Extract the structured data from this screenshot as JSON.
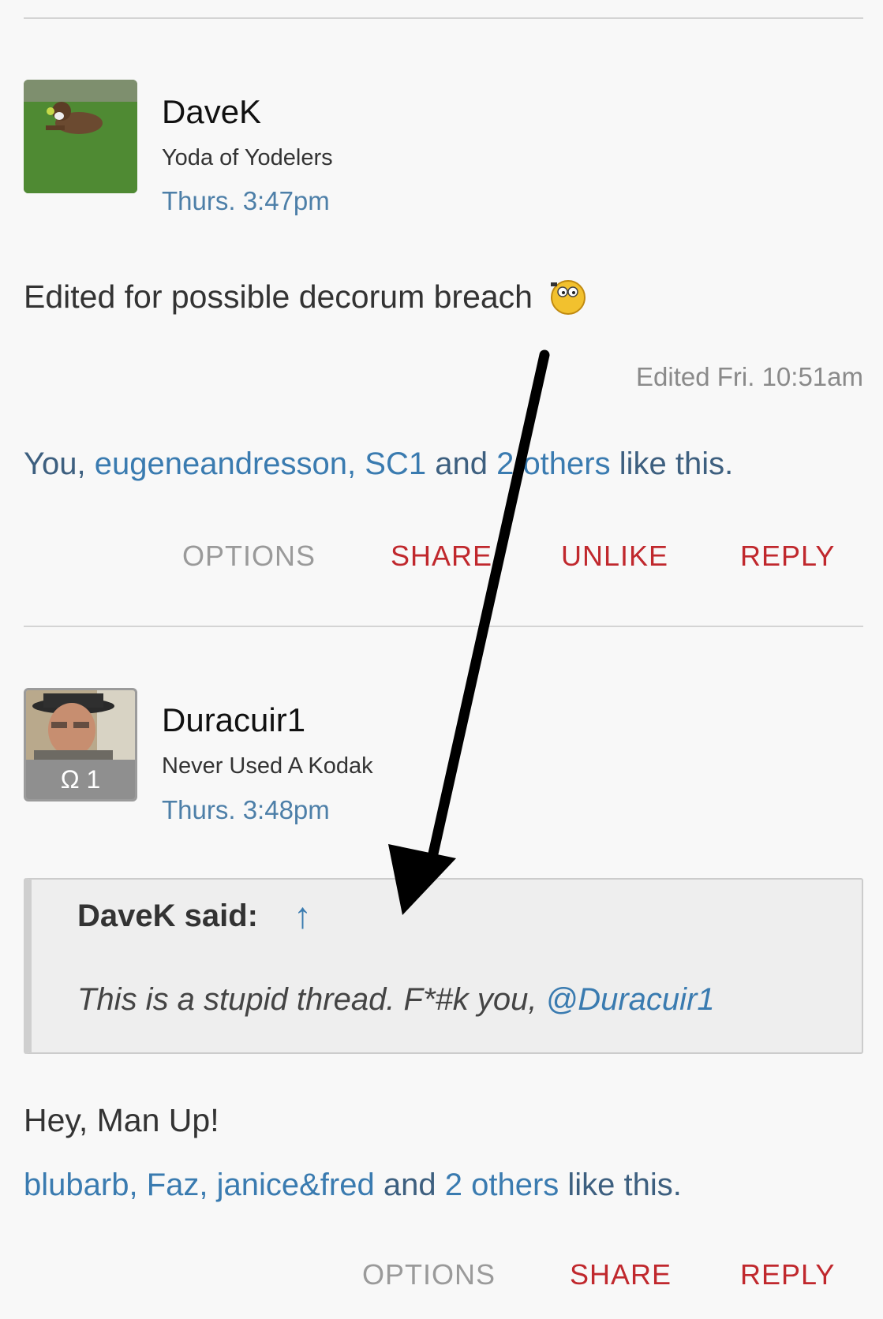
{
  "posts": [
    {
      "username": "DaveK",
      "user_title": "Yoda of Yodelers",
      "time": "Thurs. 3:47pm",
      "body": "Edited for possible decorum breach",
      "edited": "Edited Fri. 10:51am",
      "likes": {
        "you": "You,",
        "users": [
          "eugeneandresson,",
          "SC1"
        ],
        "and": "and",
        "others": "2 others",
        "suffix": "like this."
      },
      "actions": [
        "OPTIONS",
        "SHARE",
        "UNLIKE",
        "REPLY"
      ]
    },
    {
      "username": "Duracuir1",
      "user_title": "Never Used A Kodak",
      "time": "Thurs. 3:48pm",
      "badge": "Ω 1",
      "quote": {
        "author": "DaveK said:",
        "arrow": "↑",
        "text": "This is a stupid thread. F*#k you,",
        "mention": "@Duracuir1"
      },
      "body": "Hey, Man Up!",
      "likes": {
        "users": [
          "blubarb,",
          "Faz,",
          "janice&fred"
        ],
        "and": "and",
        "others": "2 others",
        "suffix": "like this."
      },
      "actions": [
        "OPTIONS",
        "SHARE",
        "REPLY"
      ]
    }
  ],
  "colors": {
    "link": "#3a7bb0",
    "action_red": "#c0282d",
    "action_grey": "#9a9a9a",
    "background": "#f8f8f8"
  }
}
